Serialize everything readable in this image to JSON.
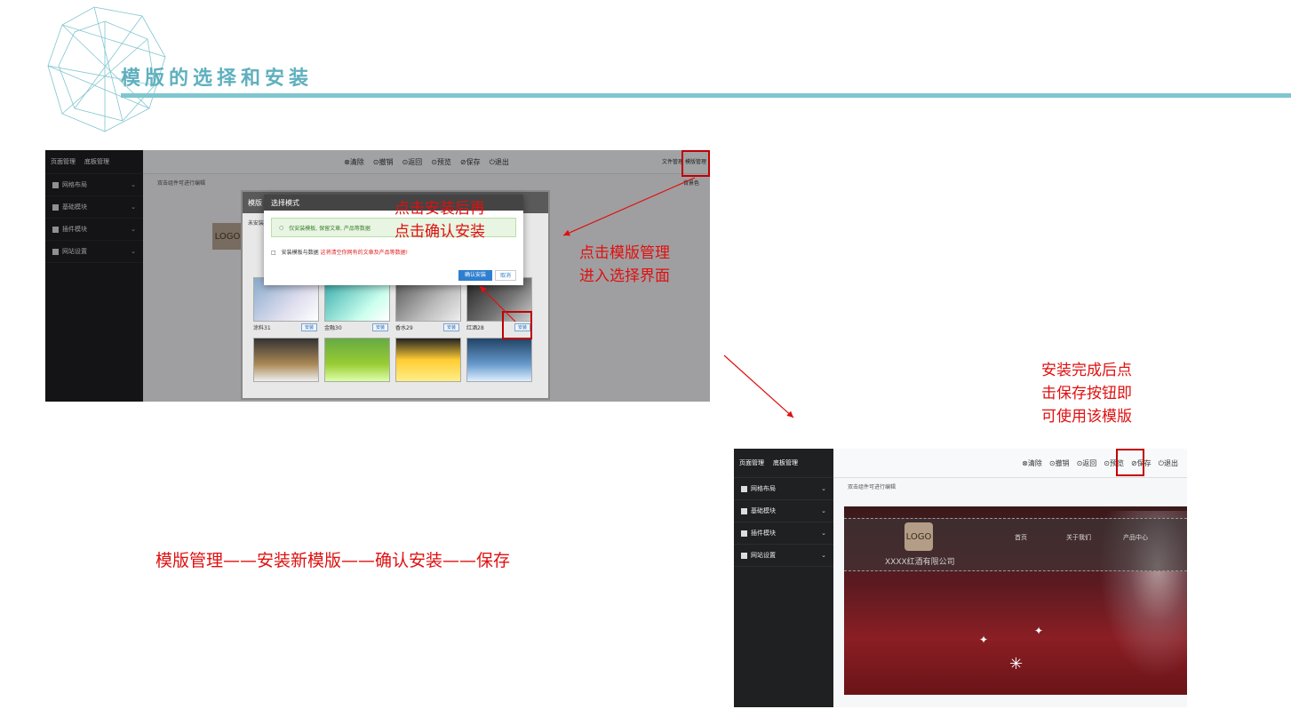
{
  "slide": {
    "title": "模版的选择和安装",
    "flow": "模版管理——安装新模版——确认安装——保存"
  },
  "annotations": {
    "click_install_line1": "点击安装后再",
    "click_install_line2": "点击确认安装",
    "click_tpl_line1": "点击模版管理",
    "click_tpl_line2": "进入选择界面",
    "after_line1": "安装完成后点",
    "after_line2": "击保存按钮即",
    "after_line3": "可使用该模版"
  },
  "shot1": {
    "sidebar": {
      "tab_page": "页面管理",
      "tab_footer": "底板管理",
      "items": [
        "网格布局",
        "基础模块",
        "插件模块",
        "网站设置"
      ]
    },
    "toolbar": [
      "⊗清除",
      "⊙撤销",
      "⊙返回",
      "⊙预览",
      "⊘保存",
      "⏻退出"
    ],
    "top_right": {
      "file": "文件管理",
      "template": "模版管理"
    },
    "sub_hint": "双击组件可进行编辑",
    "bg_color": "背景色",
    "logo": "LOGO",
    "template_window": {
      "title": "模版",
      "uninstalled": "未安装",
      "thumbs": [
        {
          "name": "涂料31",
          "btn": "安装"
        },
        {
          "name": "金融30",
          "btn": "安装"
        },
        {
          "name": "香水29",
          "btn": "安装"
        },
        {
          "name": "红酒28",
          "btn": "安装"
        }
      ]
    },
    "modal": {
      "title": "选择模式",
      "option1": "仅安装模板, 保留文章, 产品等数据",
      "option2": "安装模板与数据",
      "option2_warn": "这将清空你网有的文章及产品等数据!",
      "confirm": "确认安装",
      "cancel": "取消"
    }
  },
  "shot2": {
    "sidebar": {
      "tab_page": "页面管理",
      "tab_footer": "底板管理",
      "items": [
        "网格布局",
        "基础模块",
        "插件模块",
        "网站设置"
      ]
    },
    "toolbar": [
      "⊗清除",
      "⊙撤销",
      "⊙返回",
      "⊙预览",
      "⊘保存",
      "⏻退出"
    ],
    "sub_hint": "双击组件可进行编辑",
    "logo": "LOGO",
    "company": "XXXX红酒有限公司",
    "nav": [
      "首页",
      "关于我们",
      "产品中心"
    ]
  },
  "colors": {
    "accent": "#7fc6cf",
    "title": "#5fb0bf",
    "annotation_red": "#e01010",
    "highlight_box": "#c00000",
    "sidebar": "#1f2022"
  }
}
